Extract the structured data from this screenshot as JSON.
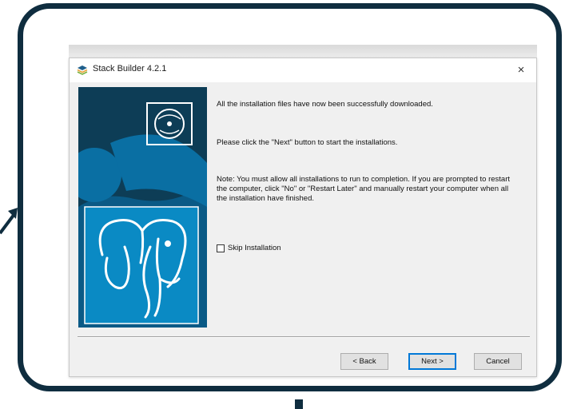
{
  "window": {
    "title": "Stack Builder 4.2.1",
    "close_glyph": "×",
    "icon": "stack-builder-icon"
  },
  "content": {
    "line1": "All the installation files have now been successfully downloaded.",
    "line2": "Please click the \"Next\" button to start the installations.",
    "note": "Note: You must allow all installations to run to completion. If you are prompted to restart the computer, click \"No\" or \"Restart Later\" and manually restart your computer when all the installation have finished.",
    "skip_label": "Skip Installation",
    "skip_checked": false
  },
  "buttons": {
    "back": "< Back",
    "next": "Next >",
    "cancel": "Cancel"
  },
  "colors": {
    "frame": "#0f2d3f",
    "banner_dark": "#0d3d56",
    "banner_light": "#0a8ac4",
    "default_button": "#0078d7"
  }
}
